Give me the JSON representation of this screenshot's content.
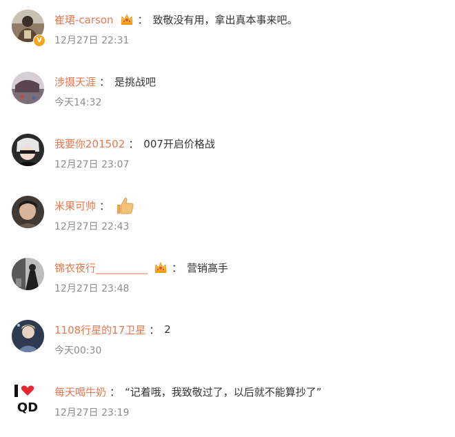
{
  "comments": [
    {
      "username": "崔珺-carson",
      "separator": "：",
      "text": "致敬没有用，拿出真本事来吧。",
      "time": "12月27日 22:31",
      "crown_badge": "crown-icon",
      "verified_badge": "V"
    },
    {
      "username": "涉摄天涯",
      "separator": "：",
      "text": "是挑战吧",
      "time": "今天14:32"
    },
    {
      "username": "我要你201502",
      "separator": "：",
      "text": "007开启价格战",
      "time": "12月27日 23:07"
    },
    {
      "username": "米果可帅",
      "separator": "：",
      "text": "",
      "emoji": "thumbs-up-icon",
      "time": "12月27日 22:43"
    },
    {
      "username": "锦衣夜行__________",
      "separator": "：",
      "text": "营销高手",
      "time": "12月27日 23:48",
      "crown_badge": "crown-icon"
    },
    {
      "username": "1108行星的17卫星",
      "separator": "：",
      "text": "2",
      "time": "今天00:30"
    },
    {
      "username": "每天喝牛奶",
      "separator": "：",
      "text": "“记着哦，我致敬过了，以后就不能算抄了”",
      "time": "12月27日 23:19",
      "avatar_logo_text": "I ♥ QD"
    }
  ],
  "colors": {
    "username": "#e8784e",
    "body_text": "#333333",
    "timestamp": "#8c8c8c",
    "background": "#ffffff"
  }
}
